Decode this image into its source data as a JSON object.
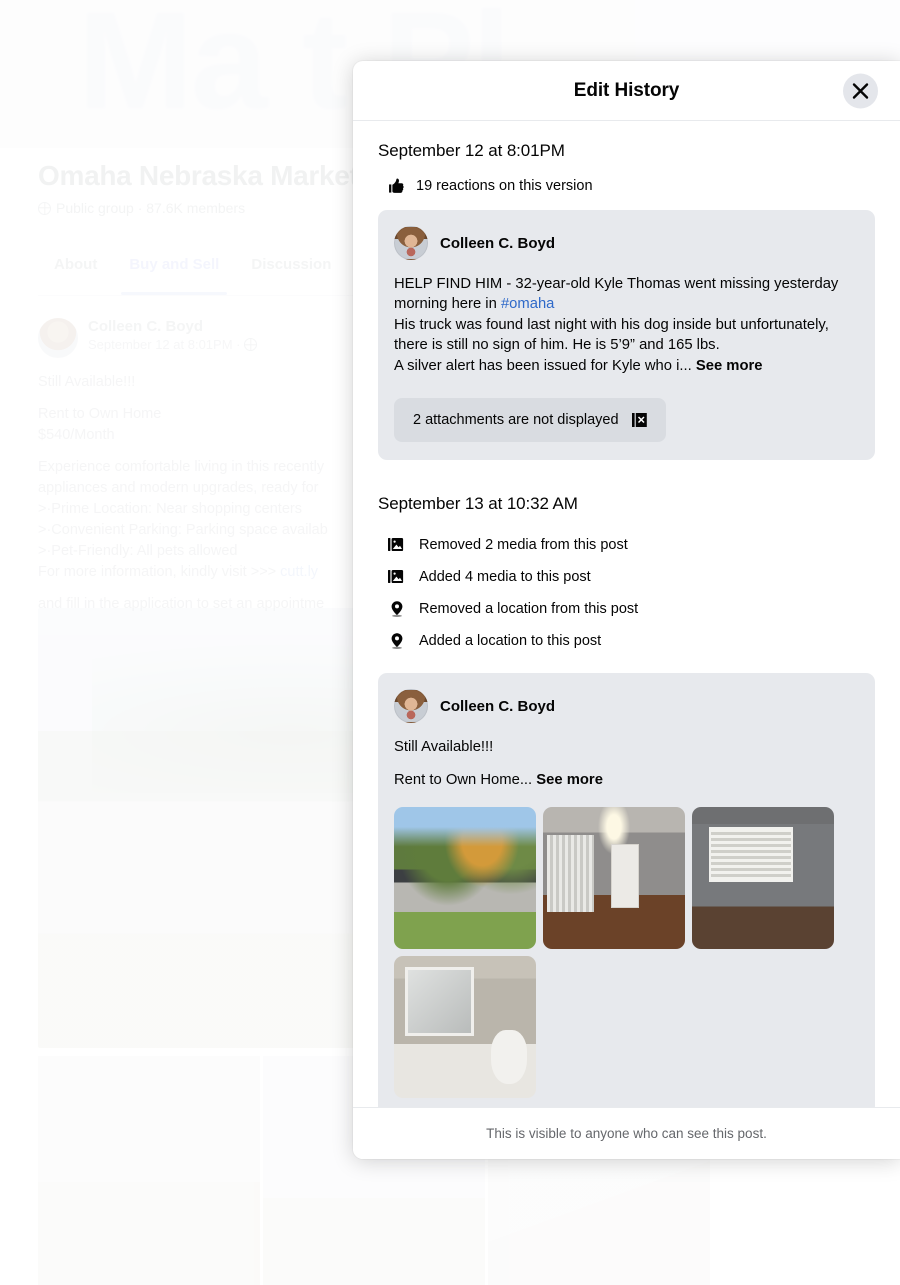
{
  "background": {
    "cover_text": "Ma        t Pl",
    "group_title": "Omaha Nebraska Market",
    "group_meta": "Public group · 87.6K members",
    "tabs": [
      {
        "label": "About",
        "active": false
      },
      {
        "label": "Buy and Sell",
        "active": true
      },
      {
        "label": "Discussion",
        "active": false
      }
    ],
    "post": {
      "author": "Colleen C. Boyd",
      "timestamp": "September 12 at 8:01PM ·",
      "line1": "Still Available!!!",
      "line2": "Rent to Own Home",
      "line3": "$540/Month",
      "line4": "Experience comfortable living in this recently",
      "line5": "appliances and modern upgrades, ready for",
      "line6": ">·Prime Location: Near shopping centers",
      "line7": ">·Convenient Parking: Parking space availab",
      "line8": ">·Pet-Friendly: All pets allowed",
      "line9": "For more information, kindly visit >>>",
      "link": "cutt.ly",
      "line10": "and fill in the application to set an appointme"
    }
  },
  "modal": {
    "title": "Edit History",
    "close_icon": "close-icon",
    "footer_note": "This is visible to anyone who can see this post.",
    "versions": [
      {
        "date": "September 12 at 8:01PM",
        "reactions_icon": "thumbs-up-icon",
        "reactions_text": "19 reactions on this version",
        "changes": [],
        "post": {
          "author": "Colleen C. Boyd",
          "text_line1": "HELP FIND HIM -   32-year-old Kyle Thomas went missing yesterday",
          "text_line2_pre": "morning here in ",
          "hashtag": "#omaha",
          "text_line3": "His truck was found last night with his dog inside but unfortunately,",
          "text_line4": "there is still no sign of him. He is 5’9” and 165 lbs.",
          "text_line5": "A silver alert has been issued for Kyle who i...",
          "see_more": "See more",
          "attachment_note": "2 attachments are not displayed",
          "attachment_icon": "broken-image-icon"
        }
      },
      {
        "date": "September 13 at 10:32 AM",
        "changes": [
          {
            "icon": "media-icon",
            "label": "Removed 2 media from this post"
          },
          {
            "icon": "media-icon",
            "label": "Added 4 media to this post"
          },
          {
            "icon": "location-pin-icon",
            "label": "Removed a location from this post"
          },
          {
            "icon": "location-pin-icon",
            "label": "Added a location to this post"
          }
        ],
        "post": {
          "author": "Colleen C. Boyd",
          "text_line1": "Still Available!!!",
          "text_line2": "Rent to Own Home...",
          "see_more": "See more",
          "photos": [
            {
              "name": "photo-house-exterior"
            },
            {
              "name": "photo-living-room-door"
            },
            {
              "name": "photo-bedroom-window"
            },
            {
              "name": "photo-bathroom"
            }
          ]
        }
      }
    ]
  },
  "colors": {
    "accent": "#2e69c9",
    "card_bg": "#e7e9ed",
    "chip_bg": "#d9dce1",
    "text_primary": "#050505",
    "text_secondary": "#65676b"
  }
}
